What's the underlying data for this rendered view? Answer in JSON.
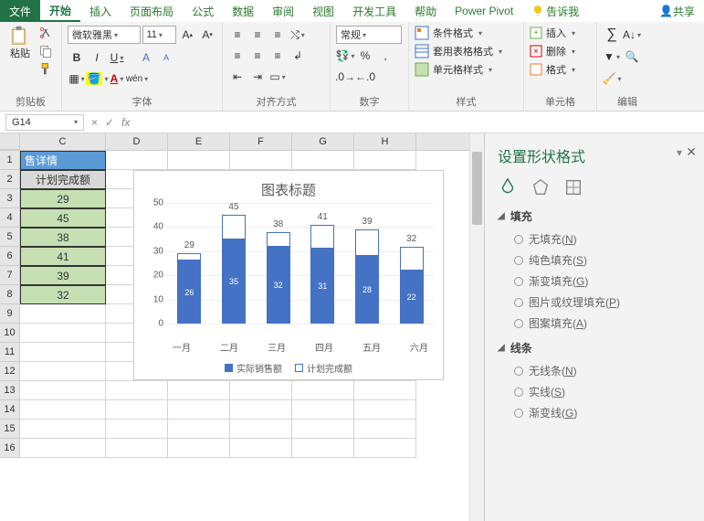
{
  "tabs": {
    "file": "文件",
    "home": "开始",
    "insert": "插入",
    "layout": "页面布局",
    "formula": "公式",
    "data": "数据",
    "review": "审阅",
    "view": "视图",
    "dev": "开发工具",
    "help": "帮助",
    "powerpivot": "Power Pivot",
    "tellme": "告诉我",
    "share": "共享"
  },
  "ribbon": {
    "clipboard": {
      "paste": "粘贴",
      "label": "剪贴板"
    },
    "font": {
      "name": "微软雅黑",
      "size": "11",
      "label": "字体"
    },
    "align": {
      "label": "对齐方式"
    },
    "number": {
      "format": "常规",
      "label": "数字"
    },
    "styles": {
      "cond": "条件格式",
      "table": "套用表格格式",
      "cell": "单元格样式",
      "label": "样式"
    },
    "cells": {
      "insert": "插入",
      "delete": "删除",
      "format": "格式",
      "label": "单元格"
    },
    "editing": {
      "label": "编辑"
    }
  },
  "namebox": "G14",
  "columns": [
    "C",
    "D",
    "E",
    "F",
    "G",
    "H"
  ],
  "rows": [
    "1",
    "2",
    "3",
    "4",
    "5",
    "6",
    "7",
    "8",
    "9",
    "10",
    "11",
    "12",
    "13",
    "14",
    "15",
    "16"
  ],
  "sheet": {
    "title": "售详情",
    "header": "计划完成额",
    "values": [
      "29",
      "45",
      "38",
      "41",
      "39",
      "32"
    ]
  },
  "chart_data": {
    "type": "bar",
    "title": "图表标题",
    "categories": [
      "一月",
      "二月",
      "三月",
      "四月",
      "五月",
      "六月"
    ],
    "series": [
      {
        "name": "实际销售额",
        "values": [
          26,
          35,
          32,
          31,
          28,
          22
        ]
      },
      {
        "name": "计划完成额",
        "values": [
          29,
          45,
          38,
          41,
          39,
          32
        ]
      }
    ],
    "ylim": [
      0,
      50
    ],
    "yticks": [
      0,
      10,
      20,
      30,
      40,
      50
    ],
    "xlabel": "",
    "ylabel": ""
  },
  "pane": {
    "title": "设置形状格式",
    "fill": {
      "title": "填充",
      "opts": [
        {
          "label": "无填充",
          "key": "N"
        },
        {
          "label": "纯色填充",
          "key": "S"
        },
        {
          "label": "渐变填充",
          "key": "G"
        },
        {
          "label": "图片或纹理填充",
          "key": "P"
        },
        {
          "label": "图案填充",
          "key": "A"
        }
      ]
    },
    "line": {
      "title": "线条",
      "opts": [
        {
          "label": "无线条",
          "key": "N"
        },
        {
          "label": "实线",
          "key": "S"
        },
        {
          "label": "渐变线",
          "key": "G"
        }
      ]
    }
  }
}
